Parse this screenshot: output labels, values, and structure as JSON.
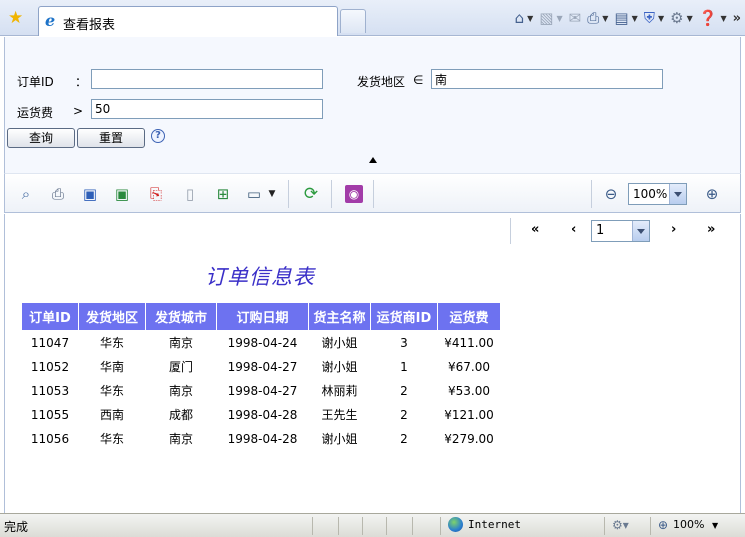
{
  "browser": {
    "tab_title": "查看报表",
    "internet_zone": "Internet",
    "status_text": "完成",
    "zoom_status": "100%"
  },
  "query": {
    "order_id_label": "订单ID",
    "order_id_op": "：",
    "order_id_value": "",
    "region_label": "发货地区",
    "region_op": "∈",
    "region_value": "南",
    "freight_label": "运货费",
    "freight_op": ">",
    "freight_value": "50",
    "query_button": "查询",
    "reset_button": "重置",
    "help_symbol": "?"
  },
  "toolbar": {
    "zoom_value": "100%"
  },
  "pager": {
    "first": "«",
    "prev": "‹",
    "page_value": "1",
    "next": "›",
    "last": "»"
  },
  "report": {
    "title": "订单信息表",
    "columns": [
      "订单ID",
      "发货地区",
      "发货城市",
      "订购日期",
      "货主名称",
      "运货商ID",
      "运货费"
    ],
    "rows": [
      [
        "11047",
        "华东",
        "南京",
        "1998-04-24",
        "谢小姐",
        "3",
        "¥411.00"
      ],
      [
        "11052",
        "华南",
        "厦门",
        "1998-04-27",
        "谢小姐",
        "1",
        "¥67.00"
      ],
      [
        "11053",
        "华东",
        "南京",
        "1998-04-27",
        "林丽莉",
        "2",
        "¥53.00"
      ],
      [
        "11055",
        "西南",
        "成都",
        "1998-04-28",
        "王先生",
        "2",
        "¥121.00"
      ],
      [
        "11056",
        "华东",
        "南京",
        "1998-04-28",
        "谢小姐",
        "2",
        "¥279.00"
      ]
    ]
  },
  "colors": {
    "header_bg": "#6d72f0",
    "title_color": "#3a2fc8"
  }
}
